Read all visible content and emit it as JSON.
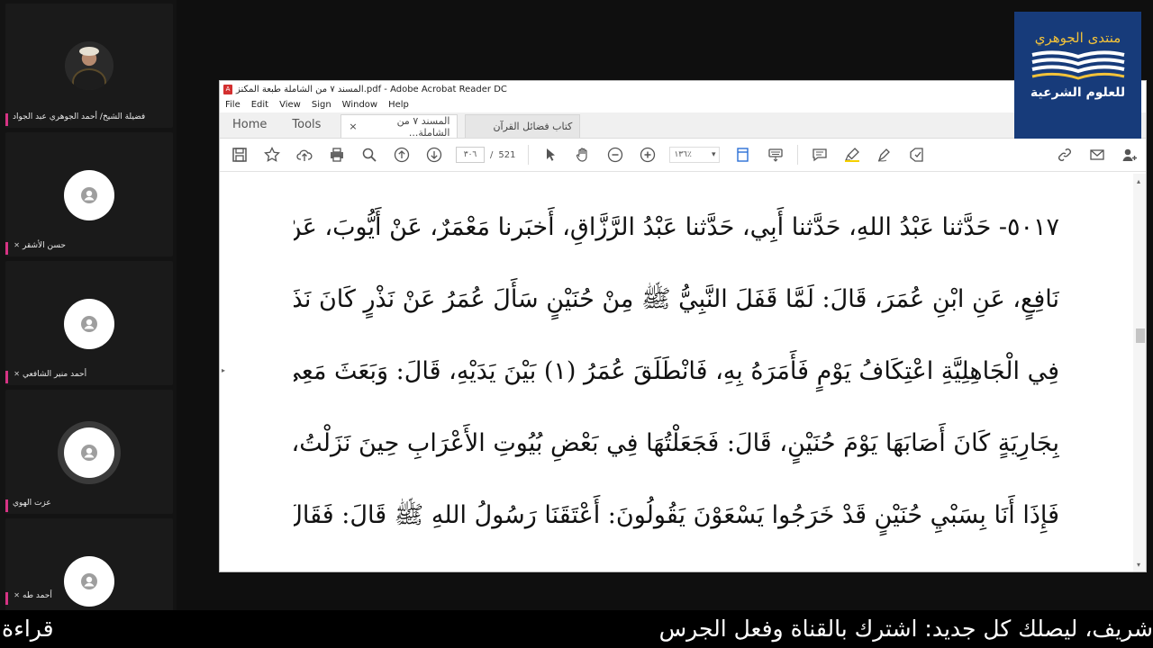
{
  "participants": [
    {
      "name": "فضيلة الشيخ/ أحمد الجوهري عبد الجواد",
      "type": "photo"
    },
    {
      "name": "حسن الأشقر",
      "type": "avatar"
    },
    {
      "name": "أحمد منير الشافعي",
      "type": "avatar"
    },
    {
      "name": "عزت الهوي",
      "type": "avatar",
      "speaking": true
    },
    {
      "name": "أحمد طه",
      "type": "avatar"
    }
  ],
  "acrobat": {
    "title": "المسند ٧ من الشاملة طبعة المكنز.pdf - Adobe Acrobat Reader DC",
    "menu": [
      "File",
      "Edit",
      "View",
      "Sign",
      "Window",
      "Help"
    ],
    "tabs": {
      "home": "Home",
      "tools": "Tools",
      "doc_active": "المسند ٧ من الشاملة...",
      "doc_other": "كتاب فضائل القرآن",
      "close": "×"
    },
    "page_current": "٣٠٦",
    "page_separator": "/",
    "page_total": "521",
    "zoom": "١٣٦٪"
  },
  "page_lines": [
    "٥٠١٧- حَدَّثنا عَبْدُ اللهِ، حَدَّثنا أَبِي، حَدَّثنا عَبْدُ الرَّزَّاقِ، أَخبَرنا مَعْمَرٌ، عَنْ أَيُّوبَ، عَنْ",
    "نَافِعٍ، عَنِ ابْنِ عُمَرَ، قَالَ: لَمَّا قَفَلَ النَّبِيُّ ﷺ مِنْ حُنَيْنٍ سَأَلَ عُمَرُ عَنْ نَذْرٍ كَانَ نَذَرَهُ",
    "فِي الْجَاهِلِيَّةِ اعْتِكَافُ يَوْمٍ فَأَمَرَهُ بِهِ، فَانْطَلَقَ عُمَرُ (١) بَيْنَ يَدَيْهِ، قَالَ: وَبَعَثَ مَعِي",
    "بِجَارِيَةٍ كَانَ أَصَابَهَا يَوْمَ حُنَيْنٍ، قَالَ: فَجَعَلْتُهَا فِي بَعْضِ بُيُوتِ الأَعْرَابِ حِينَ نَزَلْتُ،",
    "فَإِذَا أَنَا بِسَبْيِ حُنَيْنٍ قَدْ خَرَجُوا يَسْعَوْنَ يَقُولُونَ: أَعْتَقَنَا رَسُولُ اللهِ ﷺ قَالَ: فَقَالَ"
  ],
  "logo": {
    "line1": "منتدى الجوهري",
    "line2": "للعلوم الشرعية"
  },
  "ticker": {
    "left": "قراءة",
    "right": "شريف، ليصلك كل جديد: اشترك بالقناة وفعل الجرس"
  },
  "colors": {
    "speaker_bar": "#d63384",
    "logo_bg": "#173b7a",
    "logo_gold": "#f2c23a"
  }
}
